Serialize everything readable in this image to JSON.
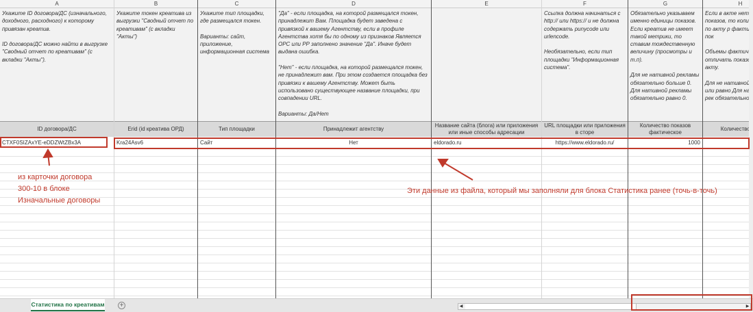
{
  "columns": [
    {
      "letter": "A",
      "instruction": "Укажите ID договора/ДС (изначального, доходного, расходного) к которому привязан креатив.\n\nID договора/ДС можно найти в выгрузке \"Сводный отчет по креативам\" (с вкладки \"Акты\").",
      "header": "ID договора/ДС",
      "value": "CTXF0SIZAxYE-eDDZWtZBx3A"
    },
    {
      "letter": "B",
      "instruction": "Укажите токен креатива из выгрузки \"Сводный отчет по креативам\" (с вкладки \"Акты\")",
      "header": "Erid (id креатива ОРД)",
      "value": "Kra24Asv6"
    },
    {
      "letter": "C",
      "instruction": "Укажите тип площадки, где размещался токен.\n\nВарианты: сайт, приложение, информационная система",
      "header": "Тип площадки",
      "value": "Сайт"
    },
    {
      "letter": "D",
      "instruction": "\"Да\" - если площадка, на которой размещался токен, принадлежит Вам. Площадка будет заведена с привязкой к вашему Агентству, если в профиле Агентства хотя бы по одному из признаков Является ОРС или РР заполнено значение \"Да\". Иначе будет выдана ошибка.\n\n\"Нет\" - если площадка, на которой размещался токен, не принадлежит вам. При этом создается площадка без привязки к вашему Агентству. Может быть использовано существующее название площадки, при совпадении URL.\n\nВарианты: Да/Нет",
      "header": "Принадлежит агентству",
      "value": "Нет"
    },
    {
      "letter": "E",
      "instruction": "",
      "header": "Название сайта (блога) или приложения или иные способы адресации",
      "value": "eldorado.ru"
    },
    {
      "letter": "F",
      "instruction": "Ссылка должна начинаться с http:// или https:// и не должна содержать punycode или urlencode.\n\nНеобязательно, если тип площадки \"Информационная система\".",
      "header": "URL площадки или приложения в сторе",
      "value": "https://www.eldorado.ru/"
    },
    {
      "letter": "G",
      "instruction": "Обязательно указываем именно единицы показов. Если креатив не имеет такой метрики, то ставим тождественную величину (просмотры и т.п).\n\nДля не нативной рекламы обязательно больше 0.\nДля нативной рекламы обязательно равно 0.",
      "header": "Количество показов фактическое",
      "value": "1000"
    },
    {
      "letter": "H",
      "instruction": "Если в акте нет е показов, то колич показов по акту р фактическим пок\n\nОбъемы фактиче могут отличать показов по акту.\n\nДля не нативной р больше или равно Для нативной рек обязательно равн",
      "header": "Количество пок",
      "value": ""
    }
  ],
  "annotations": {
    "left_note": "из карточки договора\n300-10 в блоке\nИзначальные договоры",
    "right_note": "Эти данные из файла, который мы заполняли для блока Статистика ранее (точь-в-точь)"
  },
  "sheet_tab": "Статистика по креативам",
  "add_sheet": "+"
}
